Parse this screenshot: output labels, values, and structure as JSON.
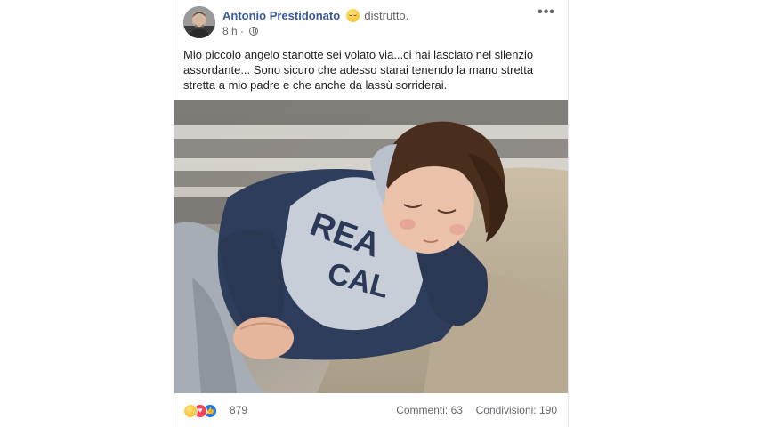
{
  "post": {
    "author": "Antonio Prestidonato",
    "feeling": "distrutto.",
    "feeling_icon": "sad-emoji-icon",
    "time": "8 h",
    "privacy_icon": "globe-icon",
    "more_label": "•••",
    "text": "Mio piccolo angelo stanotte sei volato via...ci hai lasciato nel silenzio assordante... Sono sicuro che adesso starai tenendo la mano stretta stretta a mio padre e che anche da lassù sorriderai."
  },
  "footer": {
    "reaction_icons": [
      "sad-reaction-icon",
      "love-reaction-icon",
      "like-reaction-icon"
    ],
    "reaction_count": "879",
    "comments": "Commenti: 63",
    "shares": "Condivisioni: 190"
  },
  "colors": {
    "author_link": "#385898",
    "secondary_text": "#65676b",
    "like_blue": "#1877f2",
    "love_red": "#f33e58"
  }
}
